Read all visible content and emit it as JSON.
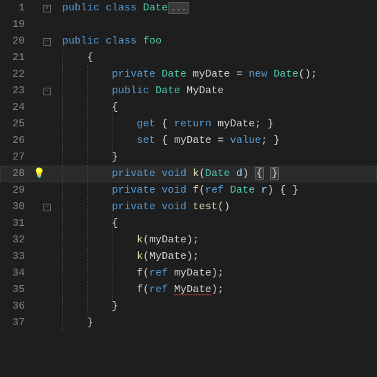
{
  "lines": [
    {
      "num": 1,
      "fold": "plus",
      "indents": 0
    },
    {
      "num": 19,
      "fold": null,
      "indents": 0
    },
    {
      "num": 20,
      "fold": "minus",
      "indents": 0
    },
    {
      "num": 21,
      "fold": null,
      "indents": 1
    },
    {
      "num": 22,
      "fold": null,
      "indents": 1
    },
    {
      "num": 23,
      "fold": "minus",
      "indents": 1
    },
    {
      "num": 24,
      "fold": null,
      "indents": 2
    },
    {
      "num": 25,
      "fold": null,
      "indents": 2
    },
    {
      "num": 26,
      "fold": null,
      "indents": 2
    },
    {
      "num": 27,
      "fold": null,
      "indents": 2
    },
    {
      "num": 28,
      "fold": null,
      "indents": 1,
      "highlighted": true,
      "bulb": true
    },
    {
      "num": 29,
      "fold": null,
      "indents": 1
    },
    {
      "num": 30,
      "fold": "minus",
      "indents": 1
    },
    {
      "num": 31,
      "fold": null,
      "indents": 2
    },
    {
      "num": 32,
      "fold": null,
      "indents": 2
    },
    {
      "num": 33,
      "fold": null,
      "indents": 2
    },
    {
      "num": 34,
      "fold": null,
      "indents": 2
    },
    {
      "num": 35,
      "fold": null,
      "indents": 2
    },
    {
      "num": 36,
      "fold": null,
      "indents": 2
    },
    {
      "num": 37,
      "fold": null,
      "indents": 1
    }
  ],
  "code": {
    "l1": {
      "kw_public": "public",
      "kw_class": "class",
      "type": "Date",
      "collapsed": "..."
    },
    "l20": {
      "kw_public": "public",
      "kw_class": "class",
      "type": "foo"
    },
    "l21": {
      "brace": "{"
    },
    "l22": {
      "kw_private": "private",
      "type": "Date",
      "field": "myDate",
      "eq": "=",
      "kw_new": "new",
      "ctor": "Date",
      "paren": "();"
    },
    "l23": {
      "kw_public": "public",
      "type": "Date",
      "prop": "MyDate"
    },
    "l24": {
      "brace": "{"
    },
    "l25": {
      "kw_get": "get",
      "b": "{ ",
      "kw_return": "return",
      "id": "myDate",
      "e": "; }"
    },
    "l26": {
      "kw_set": "set",
      "b": "{ ",
      "id": "myDate",
      "eq": "=",
      "kw_value": "value",
      "e": "; }"
    },
    "l27": {
      "brace": "}"
    },
    "l28": {
      "kw_private": "private",
      "kw_void": "void",
      "method": "k",
      "p1": "(",
      "type": "Date",
      "param": "d",
      "p2": ") ",
      "b1": "{",
      "sp": " ",
      "b2": "}"
    },
    "l29": {
      "kw_private": "private",
      "kw_void": "void",
      "method": "f",
      "p1": "(",
      "kw_ref": "ref",
      "type": "Date",
      "param": "r",
      "p2": ") { }"
    },
    "l30": {
      "kw_private": "private",
      "kw_void": "void",
      "method": "test",
      "p": "()"
    },
    "l31": {
      "brace": "{"
    },
    "l32": {
      "m": "k",
      "p1": "(",
      "arg": "myDate",
      "p2": ");"
    },
    "l33": {
      "m": "k",
      "p1": "(",
      "arg": "MyDate",
      "p2": ");"
    },
    "l34": {
      "m": "f",
      "p1": "(",
      "kw_ref": "ref",
      "arg": "myDate",
      "p2": ");"
    },
    "l35": {
      "m": "f",
      "p1": "(",
      "kw_ref": "ref",
      "arg": "MyDate",
      "p2": ");"
    },
    "l36": {
      "brace": "}"
    },
    "l37": {
      "brace": "}"
    }
  },
  "icons": {
    "fold_plus": "+",
    "fold_minus": "−",
    "bulb": "💡"
  }
}
